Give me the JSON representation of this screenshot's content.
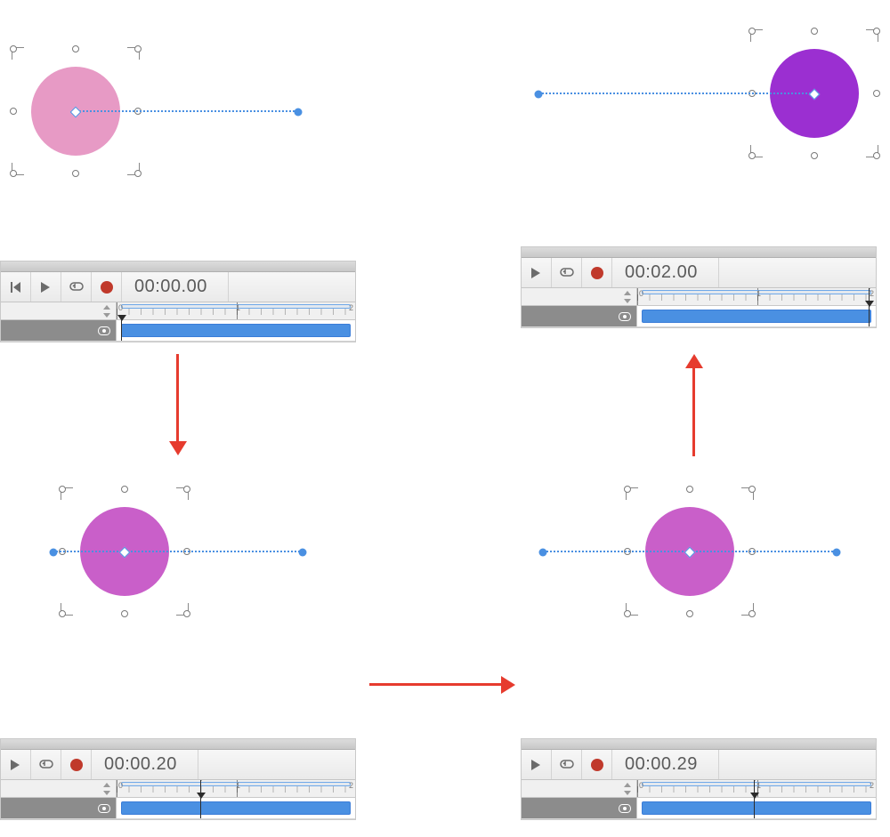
{
  "frames": {
    "top_left": {
      "circle_color": "#e79ac5",
      "path_side": "right",
      "time": "00:00.00",
      "playhead_pct": 0,
      "ruler_ticks": [
        "0",
        "1",
        "2"
      ]
    },
    "top_right": {
      "circle_color": "#9b2fd1",
      "path_side": "left",
      "time": "00:02.00",
      "playhead_pct": 100,
      "ruler_ticks": [
        "0",
        "1",
        "2"
      ]
    },
    "bottom_left": {
      "circle_color": "#c95fc9",
      "path_side": "right",
      "time": "00:00.20",
      "playhead_pct": 34,
      "ruler_ticks": [
        "0",
        "1",
        "2"
      ]
    },
    "bottom_right": {
      "circle_color": "#c95fc9",
      "path_side": "both",
      "time": "00:00.29",
      "playhead_pct": 48,
      "ruler_ticks": [
        "0",
        "1",
        "2"
      ]
    }
  },
  "timeline": {
    "clip_start_pct": 2,
    "clip_end_pct": 98,
    "scope_start_pct": 2,
    "scope_end_pct": 98,
    "ruler_max": 2
  }
}
